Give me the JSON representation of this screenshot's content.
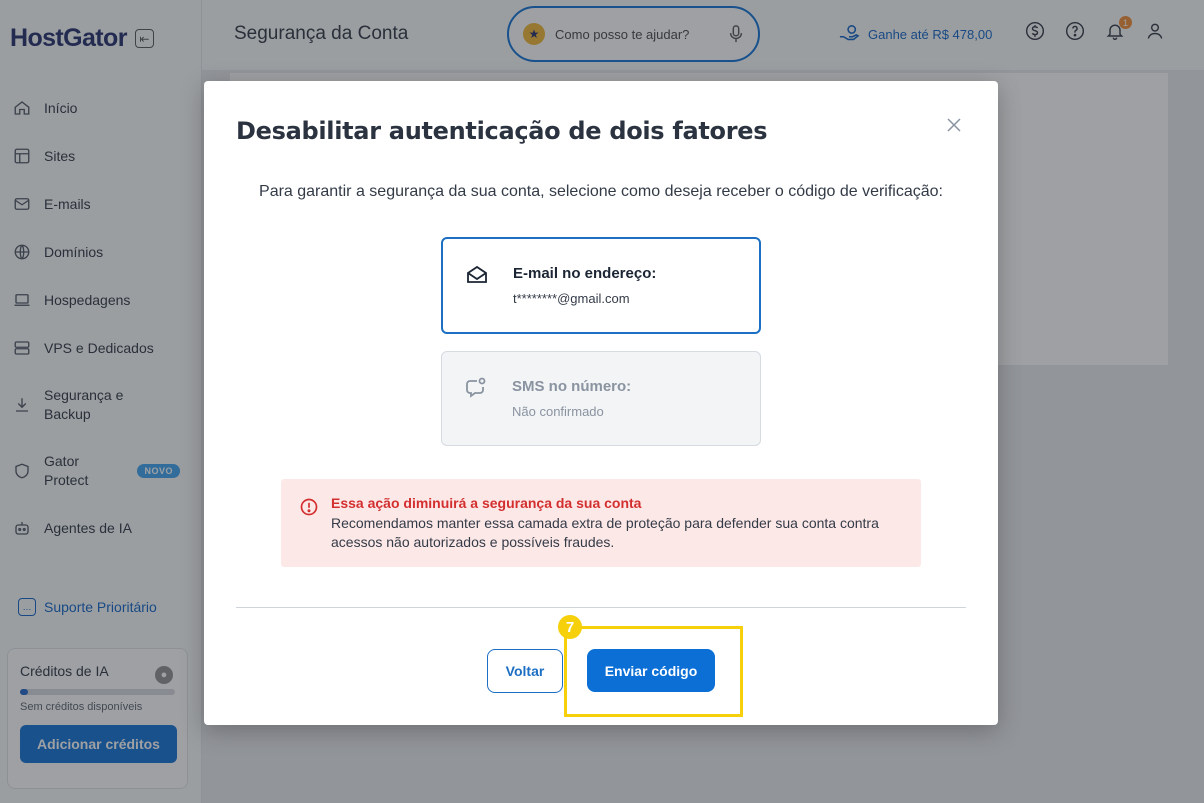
{
  "sidebar": {
    "logo": "HostGator",
    "nav": [
      {
        "label": "Início",
        "icon": "home-icon"
      },
      {
        "label": "Sites",
        "icon": "layout-icon"
      },
      {
        "label": "E-mails",
        "icon": "mail-icon"
      },
      {
        "label": "Domínios",
        "icon": "globe-icon"
      },
      {
        "label": "Hospedagens",
        "icon": "laptop-icon"
      },
      {
        "label": "VPS e Dedicados",
        "icon": "server-icon"
      },
      {
        "label": "Segurança e Backup",
        "icon": "download-icon"
      },
      {
        "label": "Gator Protect",
        "icon": "shield-icon",
        "badge": "NOVO"
      },
      {
        "label": "Agentes de IA",
        "icon": "robot-icon"
      }
    ],
    "support_label": "Suporte Prioritário",
    "credits": {
      "title": "Créditos de IA",
      "status": "Sem créditos disponíveis",
      "button": "Adicionar créditos",
      "progress": 0.05
    }
  },
  "header": {
    "title": "Segurança da Conta",
    "assistant_placeholder": "Como posso te ajudar?",
    "earn_label": "Ganhe até R$ 478,00",
    "notification_count": "1"
  },
  "modal": {
    "title": "Desabilitar autenticação de dois fatores",
    "instruction": "Para garantir a segurança da sua conta, selecione como deseja receber o código de verificação:",
    "options": [
      {
        "title": "E-mail no endereço:",
        "subtitle": "t********@gmail.com",
        "icon": "envelope-open-icon",
        "selected": true
      },
      {
        "title": "SMS no número:",
        "subtitle": "Não confirmado",
        "icon": "chat-bubble-icon",
        "disabled": true
      }
    ],
    "alert": {
      "title": "Essa ação diminuirá a segurança da sua conta",
      "text": "Recomendamos manter essa camada extra de proteção para defender sua conta contra acessos não autorizados e possíveis fraudes."
    },
    "back_label": "Voltar",
    "send_label": "Enviar código"
  },
  "annotation": {
    "step": "7"
  },
  "colors": {
    "primary": "#0b6fd6",
    "alert_bg": "#fde8e8",
    "alert_text": "#d32f2f",
    "highlight": "#f5d00b"
  }
}
